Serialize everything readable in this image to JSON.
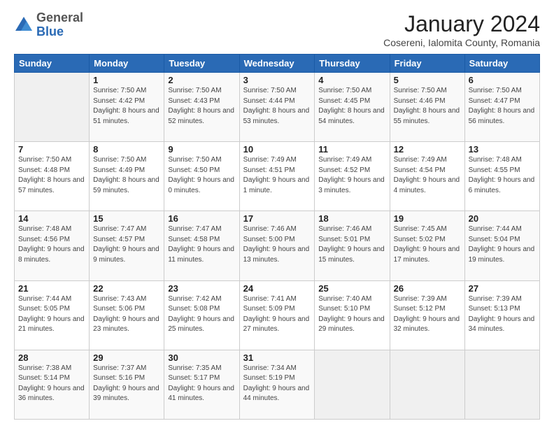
{
  "logo": {
    "general": "General",
    "blue": "Blue"
  },
  "header": {
    "month": "January 2024",
    "location": "Cosereni, Ialomita County, Romania"
  },
  "weekdays": [
    "Sunday",
    "Monday",
    "Tuesday",
    "Wednesday",
    "Thursday",
    "Friday",
    "Saturday"
  ],
  "weeks": [
    [
      {
        "day": "",
        "sunrise": "",
        "sunset": "",
        "daylight": ""
      },
      {
        "day": "1",
        "sunrise": "Sunrise: 7:50 AM",
        "sunset": "Sunset: 4:42 PM",
        "daylight": "Daylight: 8 hours and 51 minutes."
      },
      {
        "day": "2",
        "sunrise": "Sunrise: 7:50 AM",
        "sunset": "Sunset: 4:43 PM",
        "daylight": "Daylight: 8 hours and 52 minutes."
      },
      {
        "day": "3",
        "sunrise": "Sunrise: 7:50 AM",
        "sunset": "Sunset: 4:44 PM",
        "daylight": "Daylight: 8 hours and 53 minutes."
      },
      {
        "day": "4",
        "sunrise": "Sunrise: 7:50 AM",
        "sunset": "Sunset: 4:45 PM",
        "daylight": "Daylight: 8 hours and 54 minutes."
      },
      {
        "day": "5",
        "sunrise": "Sunrise: 7:50 AM",
        "sunset": "Sunset: 4:46 PM",
        "daylight": "Daylight: 8 hours and 55 minutes."
      },
      {
        "day": "6",
        "sunrise": "Sunrise: 7:50 AM",
        "sunset": "Sunset: 4:47 PM",
        "daylight": "Daylight: 8 hours and 56 minutes."
      }
    ],
    [
      {
        "day": "7",
        "sunrise": "Sunrise: 7:50 AM",
        "sunset": "Sunset: 4:48 PM",
        "daylight": "Daylight: 8 hours and 57 minutes."
      },
      {
        "day": "8",
        "sunrise": "Sunrise: 7:50 AM",
        "sunset": "Sunset: 4:49 PM",
        "daylight": "Daylight: 8 hours and 59 minutes."
      },
      {
        "day": "9",
        "sunrise": "Sunrise: 7:50 AM",
        "sunset": "Sunset: 4:50 PM",
        "daylight": "Daylight: 9 hours and 0 minutes."
      },
      {
        "day": "10",
        "sunrise": "Sunrise: 7:49 AM",
        "sunset": "Sunset: 4:51 PM",
        "daylight": "Daylight: 9 hours and 1 minute."
      },
      {
        "day": "11",
        "sunrise": "Sunrise: 7:49 AM",
        "sunset": "Sunset: 4:52 PM",
        "daylight": "Daylight: 9 hours and 3 minutes."
      },
      {
        "day": "12",
        "sunrise": "Sunrise: 7:49 AM",
        "sunset": "Sunset: 4:54 PM",
        "daylight": "Daylight: 9 hours and 4 minutes."
      },
      {
        "day": "13",
        "sunrise": "Sunrise: 7:48 AM",
        "sunset": "Sunset: 4:55 PM",
        "daylight": "Daylight: 9 hours and 6 minutes."
      }
    ],
    [
      {
        "day": "14",
        "sunrise": "Sunrise: 7:48 AM",
        "sunset": "Sunset: 4:56 PM",
        "daylight": "Daylight: 9 hours and 8 minutes."
      },
      {
        "day": "15",
        "sunrise": "Sunrise: 7:47 AM",
        "sunset": "Sunset: 4:57 PM",
        "daylight": "Daylight: 9 hours and 9 minutes."
      },
      {
        "day": "16",
        "sunrise": "Sunrise: 7:47 AM",
        "sunset": "Sunset: 4:58 PM",
        "daylight": "Daylight: 9 hours and 11 minutes."
      },
      {
        "day": "17",
        "sunrise": "Sunrise: 7:46 AM",
        "sunset": "Sunset: 5:00 PM",
        "daylight": "Daylight: 9 hours and 13 minutes."
      },
      {
        "day": "18",
        "sunrise": "Sunrise: 7:46 AM",
        "sunset": "Sunset: 5:01 PM",
        "daylight": "Daylight: 9 hours and 15 minutes."
      },
      {
        "day": "19",
        "sunrise": "Sunrise: 7:45 AM",
        "sunset": "Sunset: 5:02 PM",
        "daylight": "Daylight: 9 hours and 17 minutes."
      },
      {
        "day": "20",
        "sunrise": "Sunrise: 7:44 AM",
        "sunset": "Sunset: 5:04 PM",
        "daylight": "Daylight: 9 hours and 19 minutes."
      }
    ],
    [
      {
        "day": "21",
        "sunrise": "Sunrise: 7:44 AM",
        "sunset": "Sunset: 5:05 PM",
        "daylight": "Daylight: 9 hours and 21 minutes."
      },
      {
        "day": "22",
        "sunrise": "Sunrise: 7:43 AM",
        "sunset": "Sunset: 5:06 PM",
        "daylight": "Daylight: 9 hours and 23 minutes."
      },
      {
        "day": "23",
        "sunrise": "Sunrise: 7:42 AM",
        "sunset": "Sunset: 5:08 PM",
        "daylight": "Daylight: 9 hours and 25 minutes."
      },
      {
        "day": "24",
        "sunrise": "Sunrise: 7:41 AM",
        "sunset": "Sunset: 5:09 PM",
        "daylight": "Daylight: 9 hours and 27 minutes."
      },
      {
        "day": "25",
        "sunrise": "Sunrise: 7:40 AM",
        "sunset": "Sunset: 5:10 PM",
        "daylight": "Daylight: 9 hours and 29 minutes."
      },
      {
        "day": "26",
        "sunrise": "Sunrise: 7:39 AM",
        "sunset": "Sunset: 5:12 PM",
        "daylight": "Daylight: 9 hours and 32 minutes."
      },
      {
        "day": "27",
        "sunrise": "Sunrise: 7:39 AM",
        "sunset": "Sunset: 5:13 PM",
        "daylight": "Daylight: 9 hours and 34 minutes."
      }
    ],
    [
      {
        "day": "28",
        "sunrise": "Sunrise: 7:38 AM",
        "sunset": "Sunset: 5:14 PM",
        "daylight": "Daylight: 9 hours and 36 minutes."
      },
      {
        "day": "29",
        "sunrise": "Sunrise: 7:37 AM",
        "sunset": "Sunset: 5:16 PM",
        "daylight": "Daylight: 9 hours and 39 minutes."
      },
      {
        "day": "30",
        "sunrise": "Sunrise: 7:35 AM",
        "sunset": "Sunset: 5:17 PM",
        "daylight": "Daylight: 9 hours and 41 minutes."
      },
      {
        "day": "31",
        "sunrise": "Sunrise: 7:34 AM",
        "sunset": "Sunset: 5:19 PM",
        "daylight": "Daylight: 9 hours and 44 minutes."
      },
      {
        "day": "",
        "sunrise": "",
        "sunset": "",
        "daylight": ""
      },
      {
        "day": "",
        "sunrise": "",
        "sunset": "",
        "daylight": ""
      },
      {
        "day": "",
        "sunrise": "",
        "sunset": "",
        "daylight": ""
      }
    ]
  ]
}
